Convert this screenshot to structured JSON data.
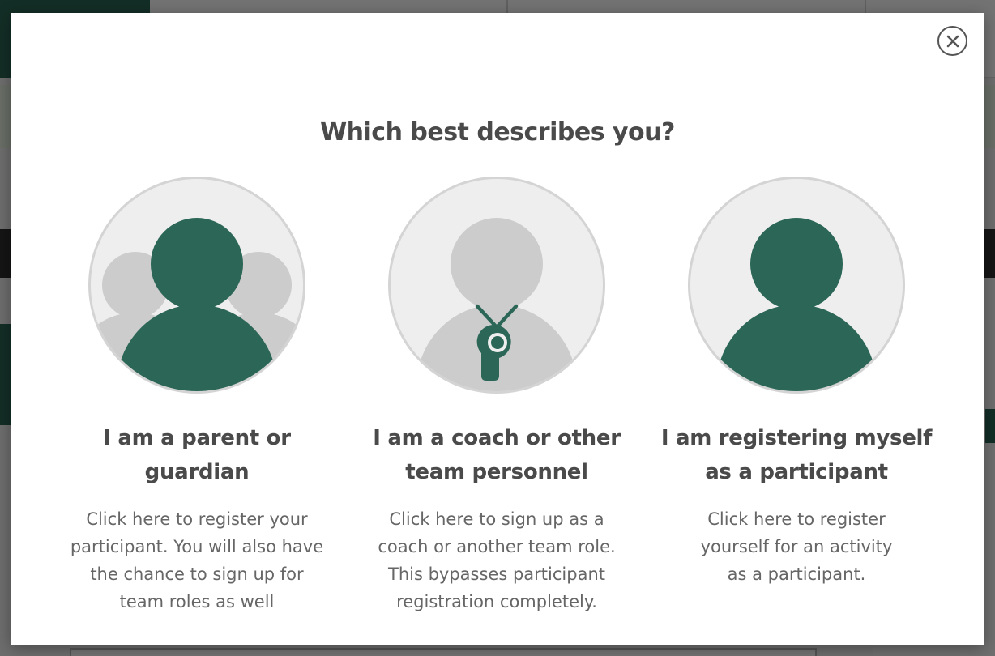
{
  "modal": {
    "title": "Which best describes you?",
    "options": [
      {
        "icon": "parent-guardian-icon",
        "heading": "I am a parent or\nguardian",
        "description": "Click here to register your\nparticipant. You will also have\nthe chance to sign up for\nteam roles as well"
      },
      {
        "icon": "coach-whistle-icon",
        "heading": "I am a coach or other\nteam personnel",
        "description": "Click here to sign up as a\ncoach or another team role.\nThis bypasses participant\nregistration completely."
      },
      {
        "icon": "participant-icon",
        "heading": "I am registering myself\nas a participant",
        "description": "Click here to register\nyourself for an activity\nas a participant."
      }
    ],
    "close_icon": "close-icon"
  },
  "colors": {
    "brand_green": "#2b6656",
    "icon_gray": "#cccccc",
    "circle_bg": "#eeeeee",
    "text_dark": "#4a4a4a",
    "text_muted": "#666666"
  }
}
